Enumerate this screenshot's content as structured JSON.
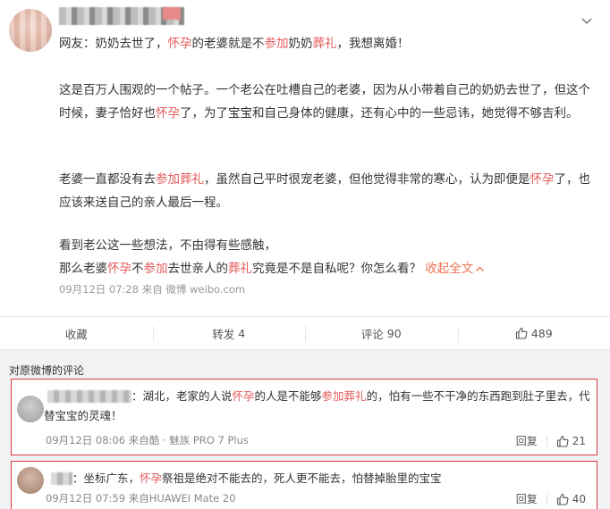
{
  "post": {
    "line1_prefix": "网友：奶奶去世了，",
    "line1_hl1": "怀孕",
    "line1_mid1": "的老婆就是不",
    "line1_hl2": "参加",
    "line1_mid2": "奶奶",
    "line1_hl3": "葬礼",
    "line1_tail": "，我想离婚！",
    "p1_a": "这是百万人围观的一个帖子。一个老公在吐槽自己的老婆，因为从小带着自己的奶奶去世了，但这个时候，妻子恰好也",
    "p1_hl": "怀孕",
    "p1_b": "了，为了宝宝和自己身体的健康，还有心中的一些忌讳，她觉得不够吉利。",
    "p2_a": "老婆一直都没有去",
    "p2_hl": "参加葬礼",
    "p2_b": "，虽然自己平时很宠老婆，但他觉得非常的寒心，认为即便是",
    "p2_hl2": "怀孕",
    "p2_c": "了，也应该来送自己的亲人最后一程。",
    "p3_line1": "看到老公这一些想法，不由得有些感触，",
    "p3_a": "那么老婆",
    "p3_hl1": "怀孕",
    "p3_b": "不",
    "p3_hl2": "参加",
    "p3_c": "去世亲人的",
    "p3_hl3": "葬礼",
    "p3_d": "究竟是不是自私呢？你怎么看？",
    "collapse_label": "收起全文",
    "meta": "09月12日 07:28 来自 微博 weibo.com"
  },
  "actions": {
    "favorite": "收藏",
    "repost_label": "转发",
    "repost_count": "4",
    "comment_label": "评论",
    "comment_count": "90",
    "like_count": "489"
  },
  "comments": {
    "section_title": "对原微博的评论",
    "items": [
      {
        "text_a": "：湖北，老家的人说",
        "hl1": "怀孕",
        "text_b": "的人是不能够",
        "hl2": "参加葬礼",
        "text_c": "的，怕有一些不干净的东西跑到肚子里去，代替宝宝的灵魂！",
        "meta": "09月12日 08:06 来自酷 · 魅族 PRO 7 Plus",
        "reply": "回复",
        "likes": "21"
      },
      {
        "text_a": "：坐标广东，",
        "hl1": "怀孕",
        "text_b": "祭祖是绝对不能去的，死人更不能去，怕替掉胎里的宝宝",
        "meta": "09月12日 07:59 来自HUAWEI Mate 20",
        "reply": "回复",
        "likes": "40"
      }
    ]
  },
  "colors": {
    "highlight": "#e35b5b",
    "link": "#eb7350",
    "card_border": "#d9363e"
  }
}
